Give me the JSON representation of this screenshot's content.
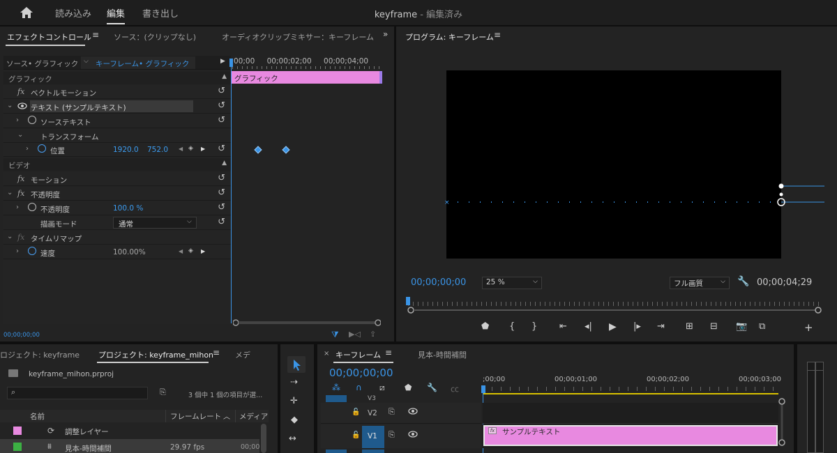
{
  "topnav": {
    "home_icon": "home-icon",
    "items": [
      "読み込み",
      "編集",
      "書き出し"
    ],
    "title": "keyframe",
    "title_suffix": " - 編集済み"
  },
  "effect_panel": {
    "tabs": [
      "エフェクトコントロール",
      "ソース：(クリップなし)",
      "オーディオクリップミキサー：キーフレーム"
    ],
    "source_label": "ソース• グラフィック",
    "sequence_label": "キーフレーム• グラフィック",
    "ruler": [
      "00;00",
      "00;00;02;00",
      "00;00;04;00"
    ],
    "clip_label": "グラフィック",
    "sections": {
      "graphics": "グラフィック",
      "video": "ビデオ"
    },
    "rows": {
      "vector_motion": "ベクトルモーション",
      "text": "テキスト (サンプルテキスト)",
      "source_text": "ソーステキスト",
      "transform": "トランスフォーム",
      "position": "位置",
      "position_x": "1920.0",
      "position_y": "752.0",
      "motion": "モーション",
      "opacity_group": "不透明度",
      "opacity": "不透明度",
      "opacity_value": "100.0 %",
      "blend_mode": "描画モード",
      "blend_value": "通常",
      "time_remap": "タイムリマップ",
      "speed": "速度",
      "speed_value": "100.00%"
    },
    "timecode": "00;00;00;00"
  },
  "program_panel": {
    "title": "プログラム: キーフレーム",
    "timecode": "00;00;00;00",
    "zoom": "25 %",
    "quality": "フル画質",
    "duration": "00;00;04;29"
  },
  "project_panel": {
    "tabs": [
      "ロジェクト: keyframe",
      "プロジェクト: keyframe_mihon",
      "メデ"
    ],
    "file": "keyframe_mihon.prproj",
    "status": "3 個中 1 個の項目が選...",
    "columns": [
      "名前",
      "フレームレート",
      "メディア"
    ],
    "items": [
      {
        "name": "調整レイヤー",
        "fps": "",
        "media": "",
        "color": "#e889e0"
      },
      {
        "name": "見本-時間補間",
        "fps": "29.97 fps",
        "media": "00;00",
        "color": "#3cb043"
      }
    ]
  },
  "timeline": {
    "tabs": [
      "キーフレーム",
      "見本-時間補間"
    ],
    "timecode": "00;00;00;00",
    "ruler": [
      ";00;00",
      "00;00;01;00",
      "00;00;02;00",
      "00;00;03;00"
    ],
    "tracks": [
      "V3",
      "V2",
      "V1"
    ],
    "v1_source": "V1",
    "clip": "サンプルテキスト"
  },
  "colors": {
    "accent": "#3a94e6",
    "clip": "#e889e0",
    "clip_border": "#e8e8e8",
    "playhead": "#3a94e6"
  }
}
